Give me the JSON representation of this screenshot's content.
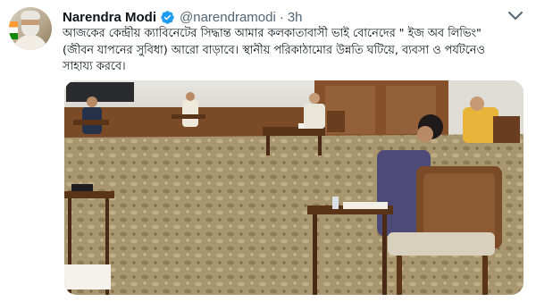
{
  "tweet": {
    "author": {
      "name": "Narendra Modi",
      "handle": "@narendramodi",
      "verified_icon": "verified-badge-icon"
    },
    "separator": "·",
    "time": "3h",
    "menu_icon": "more-chevron-icon",
    "text_lines": [
      "আজকের কেন্দ্রীয় ক্যাবিনেটের সিদ্ধান্ত আমার কলকাতাবাসী ভাই বোনেদের \" ইজ অব লিভিং\"",
      "(জীবন যাপনের সুবিধা) আরো বাড়াবে। স্থানীয় পরিকাঠামোর উন্নতি ঘটিয়ে, ব্যবসা ও পর্যটনেও",
      "সাহায্য করবে।"
    ],
    "media": {
      "type": "photo"
    }
  },
  "colors": {
    "verified": "#1d9bf0",
    "secondary_text": "#536471",
    "primary_text": "#0f1419"
  }
}
